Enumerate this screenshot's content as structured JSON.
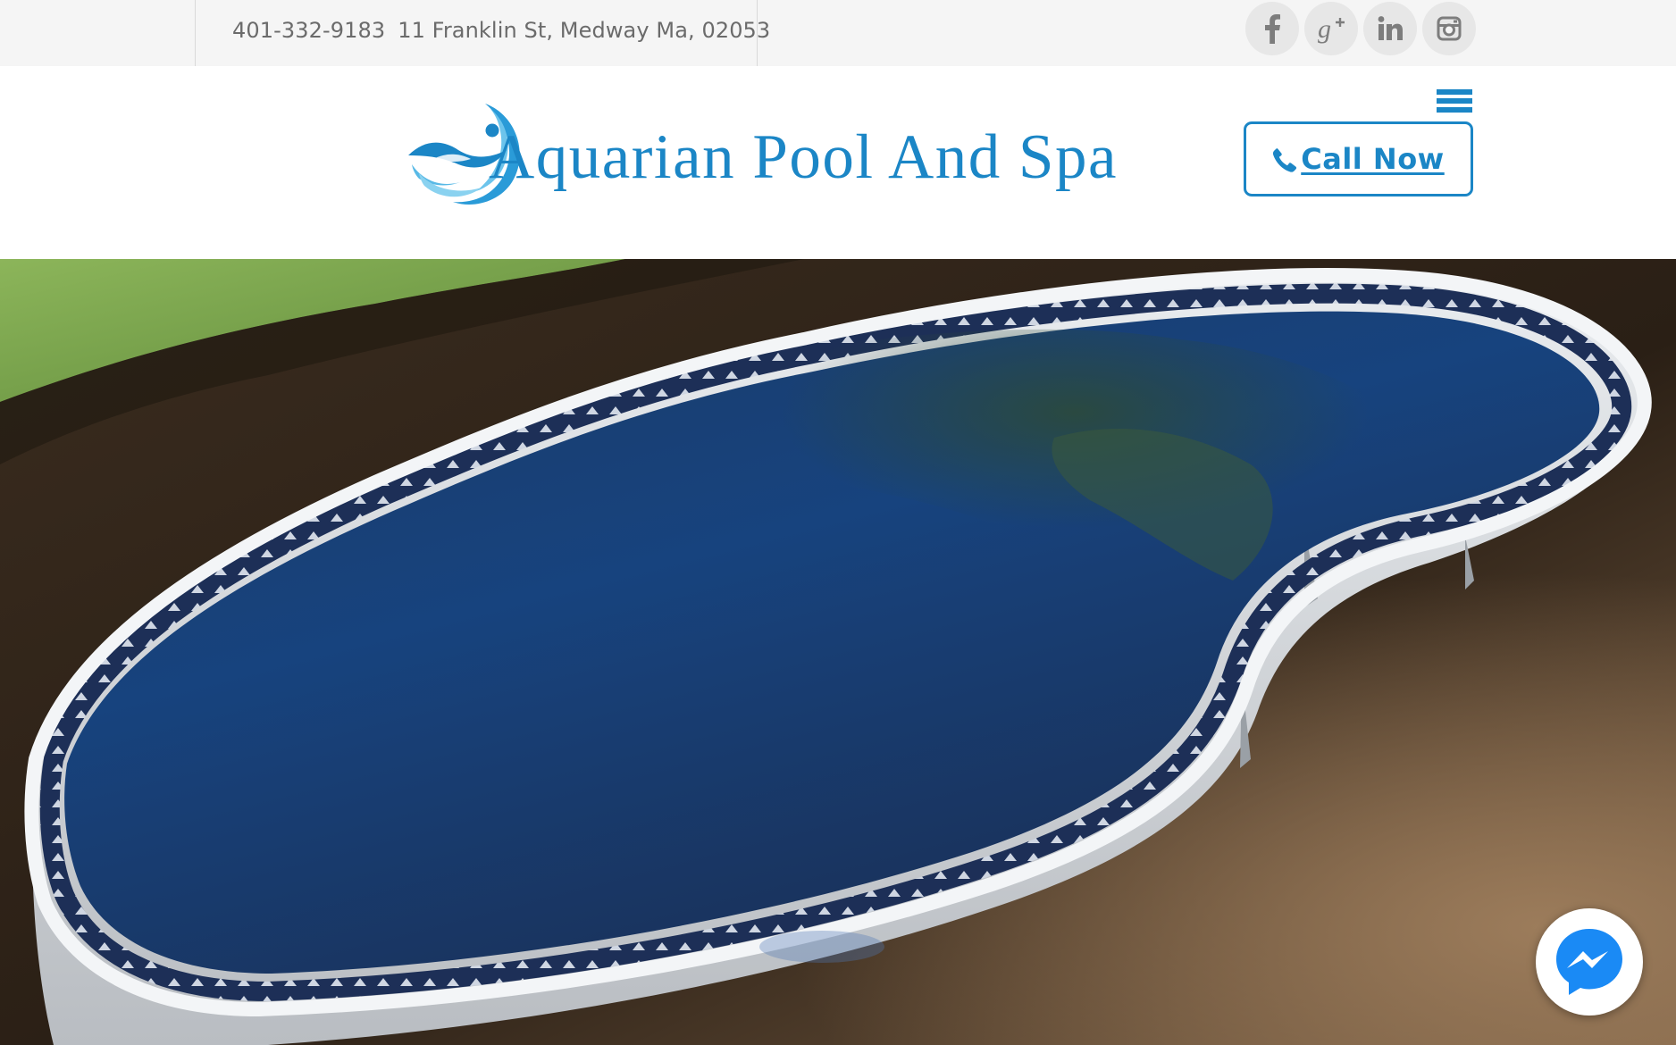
{
  "topbar": {
    "phone": "401-332-9183",
    "address": "11 Franklin St, Medway Ma, 02053",
    "social": [
      {
        "icon": "facebook-icon",
        "label": "f"
      },
      {
        "icon": "google-plus-icon",
        "label": "g+"
      },
      {
        "icon": "linkedin-icon",
        "label": "in"
      },
      {
        "icon": "instagram-icon",
        "label": ""
      }
    ]
  },
  "header": {
    "brand": "Aquarian Pool And Spa",
    "menu_icon": "hamburger-menu-icon",
    "call_label": "Call Now",
    "call_icon": "phone-icon"
  },
  "hero": {
    "image": "above-ground pool photo"
  },
  "chat": {
    "icon": "messenger-icon"
  },
  "colors": {
    "brand_blue": "#1b86c6",
    "topbar_bg": "#f5f5f5",
    "social_bg": "#e7e7e7",
    "social_fg": "#7d7d7d",
    "messenger_blue": "#1a8af5"
  }
}
